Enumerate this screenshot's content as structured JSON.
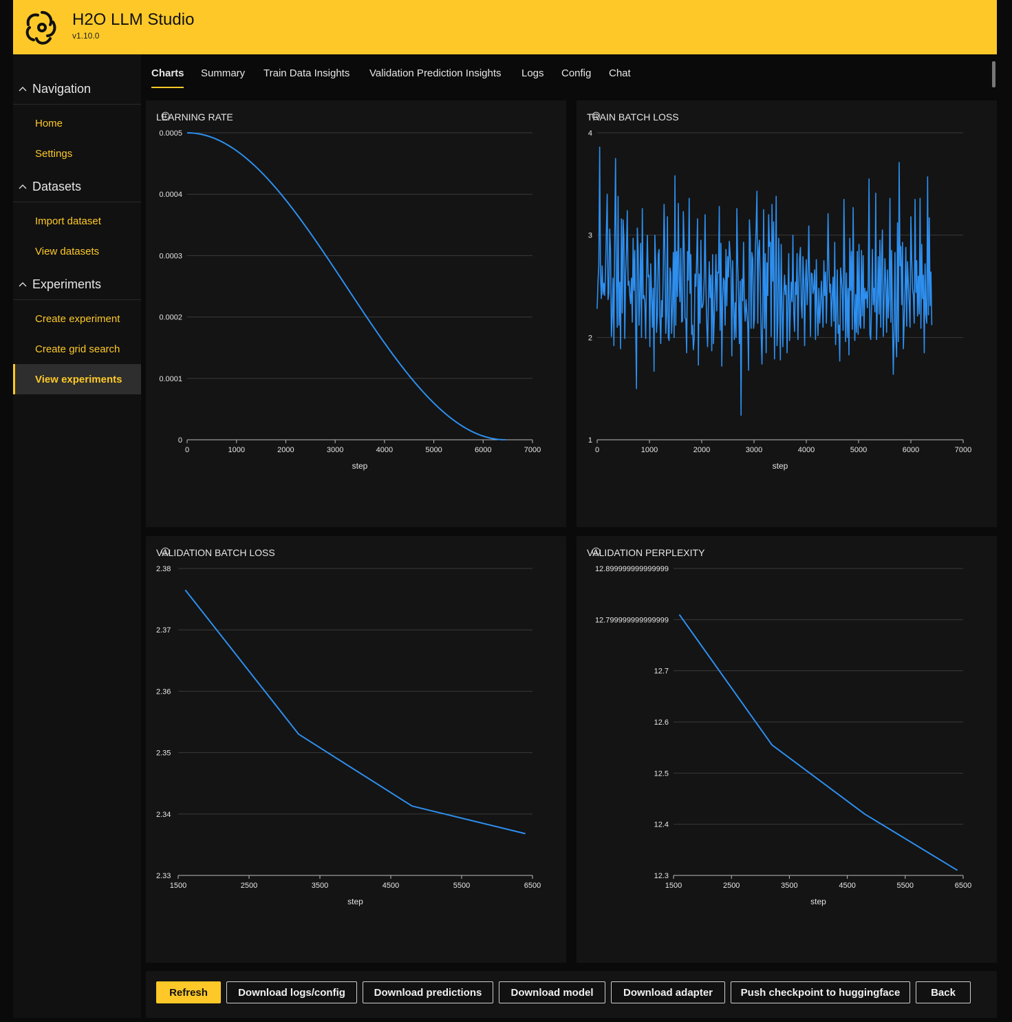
{
  "header": {
    "title": "H2O LLM Studio",
    "version": "v1.10.0"
  },
  "sidebar": {
    "groups": [
      {
        "label": "Navigation",
        "items": [
          "Home",
          "Settings"
        ]
      },
      {
        "label": "Datasets",
        "items": [
          "Import dataset",
          "View datasets"
        ]
      },
      {
        "label": "Experiments",
        "items": [
          "Create experiment",
          "Create grid search",
          "View experiments"
        ]
      }
    ],
    "active_item": "View experiments"
  },
  "tabs": [
    "Charts",
    "Summary",
    "Train Data Insights",
    "Validation Prediction Insights",
    "Logs",
    "Config",
    "Chat"
  ],
  "active_tab": "Charts",
  "buttons": {
    "refresh": "Refresh",
    "download_logs": "Download logs/config",
    "download_predictions": "Download predictions",
    "download_model": "Download model",
    "download_adapter": "Download adapter",
    "push_checkpoint": "Push checkpoint to huggingface",
    "back": "Back"
  },
  "colors": {
    "accent": "#fec928",
    "series": "#2d8ff0",
    "card": "#141414",
    "grid": "#3a3a3a"
  },
  "chart_data": [
    {
      "type": "line",
      "title": "LEARNING RATE",
      "xlabel": "step",
      "ylabel": "",
      "xlim": [
        0,
        7000
      ],
      "ylim": [
        0,
        0.0005
      ],
      "xticks": [
        "0",
        "1000",
        "2000",
        "3000",
        "4000",
        "5000",
        "6000",
        "7000"
      ],
      "yticks": [
        "0",
        "0.0001",
        "0.0002",
        "0.0003",
        "0.0004",
        "0.0005"
      ],
      "grid": true,
      "series": [
        {
          "shape": "cosine",
          "x_start": 0,
          "x_end": 6450,
          "y_start": 0.0005,
          "y_end": 0
        }
      ]
    },
    {
      "type": "line",
      "title": "TRAIN BATCH LOSS",
      "xlabel": "step",
      "ylabel": "",
      "xlim": [
        0,
        7000
      ],
      "ylim": [
        1,
        4
      ],
      "xticks": [
        "0",
        "1000",
        "2000",
        "3000",
        "4000",
        "5000",
        "6000",
        "7000"
      ],
      "yticks": [
        "1",
        "2",
        "3",
        "4"
      ],
      "grid": true,
      "series": [
        {
          "x_start": 0,
          "x_end": 6400,
          "values": [
            2.28,
            2.55,
            2.71,
            3.86,
            2.6,
            2.38,
            2.7,
            2.42,
            2.53,
            2.41,
            2.64,
            3.04,
            3.4,
            2.37,
            2.43,
            3.06,
            2.85,
            2.01,
            2.2,
            2.58,
            1.92,
            3.01,
            3.75,
            2.53,
            2.1,
            3.38,
            2.12,
            2.54,
            1.89,
            3.16,
            2.24,
            3.15,
            2.97,
            1.99,
            2.61,
            2.84,
            3.24,
            2.51,
            2.55,
            2.42,
            2.33,
            2.58,
            2.15,
            2.97,
            2.46,
            2.85,
            2.13,
            1.5,
            3.07,
            2.86,
            2.12,
            2.45,
            2.92,
            2.0,
            3.26,
            2.38,
            2.41,
            2.34,
            1.99,
            2.57,
            3.0,
            2.59,
            2.61,
            1.91,
            2.72,
            2.44,
            2.1,
            2.48,
            1.67,
            3.0,
            2.72,
            2.05,
            2.21,
            2.81,
            2.86,
            2.2,
            1.94,
            2.36,
            2.2,
            2.64,
            3.3,
            2.81,
            2.04,
            2.22,
            3.18,
            2.0,
            1.97,
            2.68,
            2.63,
            2.04,
            2.29,
            2.83,
            2.0,
            3.58,
            2.12,
            2.84,
            2.4,
            3.31,
            2.58,
            2.35,
            2.87,
            2.15,
            2.16,
            3.23,
            2.91,
            2.19,
            2.18,
            1.85,
            2.84,
            2.56,
            3.36,
            2.43,
            2.81,
            2.03,
            2.12,
            1.88,
            1.99,
            2.62,
            2.5,
            2.78,
            3.16,
            1.73,
            2.62,
            2.14,
            2.95,
            2.29,
            2.3,
            2.35,
            2.58,
            3.2,
            2.51,
            2.13,
            1.91,
            2.32,
            2.74,
            2.39,
            2.61,
            1.87,
            2.81,
            1.94,
            2.18,
            2.47,
            2.81,
            2.26,
            2.64,
            2.63,
            3.28,
            2.07,
            2.92,
            1.72,
            2.38,
            2.58,
            2.55,
            2.12,
            2.86,
            2.31,
            2.79,
            2.59,
            2.94,
            2.81,
            2.65,
            1.82,
            2.75,
            2.34,
            1.98,
            2.34,
            2.0,
            3.26,
            2.72,
            2.41,
            1.94,
            2.55,
            1.24,
            2.57,
            2.36,
            2.93,
            2.31,
            2.16,
            2.37,
            2.24,
            2.13,
            1.68,
            3.15,
            2.96,
            2.09,
            2.83,
            2.77,
            2.09,
            2.18,
            2.83,
            3.07,
            3.43,
            2.14,
            2.85,
            2.95,
            2.51,
            2.05,
            1.74,
            2.27,
            3.25,
            2.09,
            2.82,
            1.85,
            2.73,
            2.41,
            3.2,
            2.89,
            2.93,
            2.01,
            3.3,
            2.55,
            3.13,
            1.79,
            2.5,
            3.38,
            1.92,
            2.15,
            2.97,
            2.45,
            1.78,
            2.91,
            2.29,
            1.91,
            2.39,
            2.61,
            2.42,
            2.51,
            1.85,
            2.35,
            2.82,
            1.97,
            2.28,
            2.54,
            2.35,
            3.0,
            2.24,
            2.06,
            2.54,
            2.42,
            2.82,
            1.98,
            2.49,
            2.78,
            2.88,
            2.32,
            2.19,
            2.79,
            2.53,
            1.92,
            2.55,
            2.76,
            2.32,
            2.56,
            3.09,
            2.54,
            2.01,
            2.63,
            2.62,
            2.43,
            2.48,
            2.66,
            1.98,
            2.76,
            2.28,
            2.02,
            2.48,
            2.14,
            2.3,
            2.55,
            2.36,
            2.1,
            2.75,
            2.41,
            2.64,
            2.14,
            2.56,
            3.21,
            2.7,
            2.44,
            2.52,
            2.11,
            2.41,
            2.59,
            2.16,
            2.93,
            1.93,
            2.26,
            2.66,
            2.04,
            2.12,
            1.77,
            2.68,
            2.57,
            2.44,
            2.07,
            3.35,
            2.66,
            1.96,
            2.63,
            2.0,
            2.48,
            1.83,
            2.97,
            2.46,
            2.84,
            2.08,
            3.27,
            2.36,
            1.97,
            2.42,
            2.05,
            2.84,
            2.03,
            2.91,
            2.13,
            2.09,
            2.85,
            2.21,
            2.8,
            2.09,
            2.48,
            2.38,
            2.45,
            2.29,
            2.52,
            3.55,
            2.03,
            1.98,
            2.3,
            2.86,
            2.32,
            2.48,
            2.25,
            3.41,
            1.98,
            2.31,
            2.79,
            2.23,
            2.95,
            2.1,
            2.8,
            3.05,
            2.01,
            2.35,
            2.77,
            2.52,
            2.05,
            2.66,
            2.19,
            2.38,
            3.36,
            2.15,
            2.85,
            2.17,
            1.64,
            2.09,
            2.83,
            2.02,
            1.81,
            3.12,
            1.96,
            3.71,
            2.7,
            2.89,
            2.32,
            2.93,
            1.89,
            2.14,
            2.46,
            2.88,
            2.11,
            2.74,
            2.53,
            2.33,
            2.1,
            3.18,
            2.76,
            2.47,
            2.41,
            2.14,
            3.35,
            2.44,
            2.75,
            2.21,
            2.6,
            2.23,
            3.36,
            2.09,
            2.91,
            2.38,
            2.61,
            1.85,
            2.72,
            2.23,
            2.14,
            3.57,
            2.22,
            3.17,
            2.31,
            2.64,
            2.12
          ]
        }
      ]
    },
    {
      "type": "line",
      "title": "VALIDATION BATCH LOSS",
      "xlabel": "step",
      "ylabel": "",
      "xlim": [
        1500,
        6500
      ],
      "ylim": [
        2.33,
        2.38
      ],
      "xticks": [
        "1500",
        "2500",
        "3500",
        "4500",
        "5500",
        "6500"
      ],
      "yticks": [
        "2.33",
        "2.34",
        "2.35",
        "2.36",
        "2.37",
        "2.38"
      ],
      "grid": true,
      "series": [
        {
          "x": [
            1600,
            3200,
            4800,
            6400
          ],
          "values": [
            2.3765,
            2.353,
            2.3413,
            2.3368
          ]
        }
      ]
    },
    {
      "type": "line",
      "title": "VALIDATION PERPLEXITY",
      "xlabel": "step",
      "ylabel": "",
      "xlim": [
        1500,
        6500
      ],
      "ylim": [
        12.3,
        12.9
      ],
      "xticks": [
        "1500",
        "2500",
        "3500",
        "4500",
        "5500",
        "6500"
      ],
      "yticks": [
        "12.3",
        "12.4",
        "12.5",
        "12.6",
        "12.7",
        "12.799999999999999",
        "12.899999999999999"
      ],
      "grid": true,
      "series": [
        {
          "x": [
            1600,
            3200,
            4800,
            6400
          ],
          "values": [
            12.81,
            12.555,
            12.42,
            12.31
          ]
        }
      ]
    }
  ]
}
